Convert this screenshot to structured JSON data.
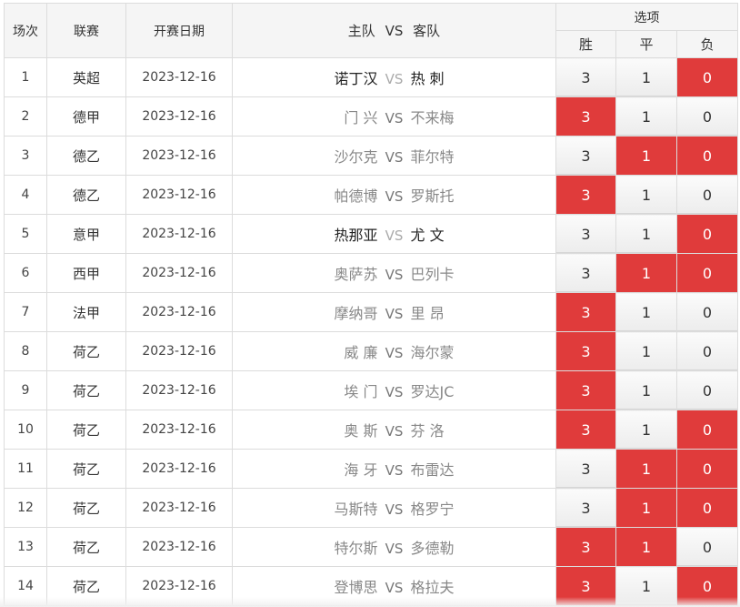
{
  "headers": {
    "index": "场次",
    "league": "联赛",
    "date": "开赛日期",
    "match_home": "主队",
    "match_vs": "VS",
    "match_away": "客队",
    "options": "选项",
    "win": "胜",
    "draw": "平",
    "loss": "负"
  },
  "colors": {
    "selected": "#e03b3b",
    "header_bg": "#f5f5f5",
    "border": "#dcdcdc"
  },
  "rows": [
    {
      "index": "1",
      "league": "英超",
      "date": "2023-12-16",
      "home": "诺丁汉",
      "vs": "VS",
      "away": "热 刺",
      "win": "3",
      "draw": "1",
      "loss": "0",
      "selected": [
        "loss"
      ]
    },
    {
      "index": "2",
      "league": "德甲",
      "date": "2023-12-16",
      "home": "门 兴",
      "vs": "VS",
      "away": "不来梅",
      "win": "3",
      "draw": "1",
      "loss": "0",
      "selected": [
        "win"
      ]
    },
    {
      "index": "3",
      "league": "德乙",
      "date": "2023-12-16",
      "home": "沙尔克",
      "vs": "VS",
      "away": "菲尔特",
      "win": "3",
      "draw": "1",
      "loss": "0",
      "selected": [
        "draw",
        "loss"
      ]
    },
    {
      "index": "4",
      "league": "德乙",
      "date": "2023-12-16",
      "home": "帕德博",
      "vs": "VS",
      "away": "罗斯托",
      "win": "3",
      "draw": "1",
      "loss": "0",
      "selected": [
        "win"
      ]
    },
    {
      "index": "5",
      "league": "意甲",
      "date": "2023-12-16",
      "home": "热那亚",
      "vs": "VS",
      "away": "尤 文",
      "win": "3",
      "draw": "1",
      "loss": "0",
      "selected": [
        "loss"
      ]
    },
    {
      "index": "6",
      "league": "西甲",
      "date": "2023-12-16",
      "home": "奥萨苏",
      "vs": "VS",
      "away": "巴列卡",
      "win": "3",
      "draw": "1",
      "loss": "0",
      "selected": [
        "draw",
        "loss"
      ]
    },
    {
      "index": "7",
      "league": "法甲",
      "date": "2023-12-16",
      "home": "摩纳哥",
      "vs": "VS",
      "away": "里 昂",
      "win": "3",
      "draw": "1",
      "loss": "0",
      "selected": [
        "win"
      ]
    },
    {
      "index": "8",
      "league": "荷乙",
      "date": "2023-12-16",
      "home": "威 廉",
      "vs": "VS",
      "away": "海尔蒙",
      "win": "3",
      "draw": "1",
      "loss": "0",
      "selected": [
        "win"
      ]
    },
    {
      "index": "9",
      "league": "荷乙",
      "date": "2023-12-16",
      "home": "埃 门",
      "vs": "VS",
      "away": "罗达JC",
      "win": "3",
      "draw": "1",
      "loss": "0",
      "selected": [
        "win"
      ]
    },
    {
      "index": "10",
      "league": "荷乙",
      "date": "2023-12-16",
      "home": "奥 斯",
      "vs": "VS",
      "away": "芬 洛",
      "win": "3",
      "draw": "1",
      "loss": "0",
      "selected": [
        "win",
        "loss"
      ]
    },
    {
      "index": "11",
      "league": "荷乙",
      "date": "2023-12-16",
      "home": "海 牙",
      "vs": "VS",
      "away": "布雷达",
      "win": "3",
      "draw": "1",
      "loss": "0",
      "selected": [
        "draw",
        "loss"
      ]
    },
    {
      "index": "12",
      "league": "荷乙",
      "date": "2023-12-16",
      "home": "马斯特",
      "vs": "VS",
      "away": "格罗宁",
      "win": "3",
      "draw": "1",
      "loss": "0",
      "selected": [
        "draw",
        "loss"
      ]
    },
    {
      "index": "13",
      "league": "荷乙",
      "date": "2023-12-16",
      "home": "特尔斯",
      "vs": "VS",
      "away": "多德勒",
      "win": "3",
      "draw": "1",
      "loss": "0",
      "selected": [
        "win",
        "draw"
      ]
    },
    {
      "index": "14",
      "league": "荷乙",
      "date": "2023-12-16",
      "home": "登博思",
      "vs": "VS",
      "away": "格拉夫",
      "win": "3",
      "draw": "1",
      "loss": "0",
      "selected": [
        "win",
        "loss"
      ]
    }
  ],
  "row_style": [
    "strong",
    "muted",
    "muted",
    "muted",
    "strong",
    "muted",
    "muted",
    "muted",
    "muted",
    "muted",
    "muted",
    "muted",
    "muted",
    "muted"
  ]
}
